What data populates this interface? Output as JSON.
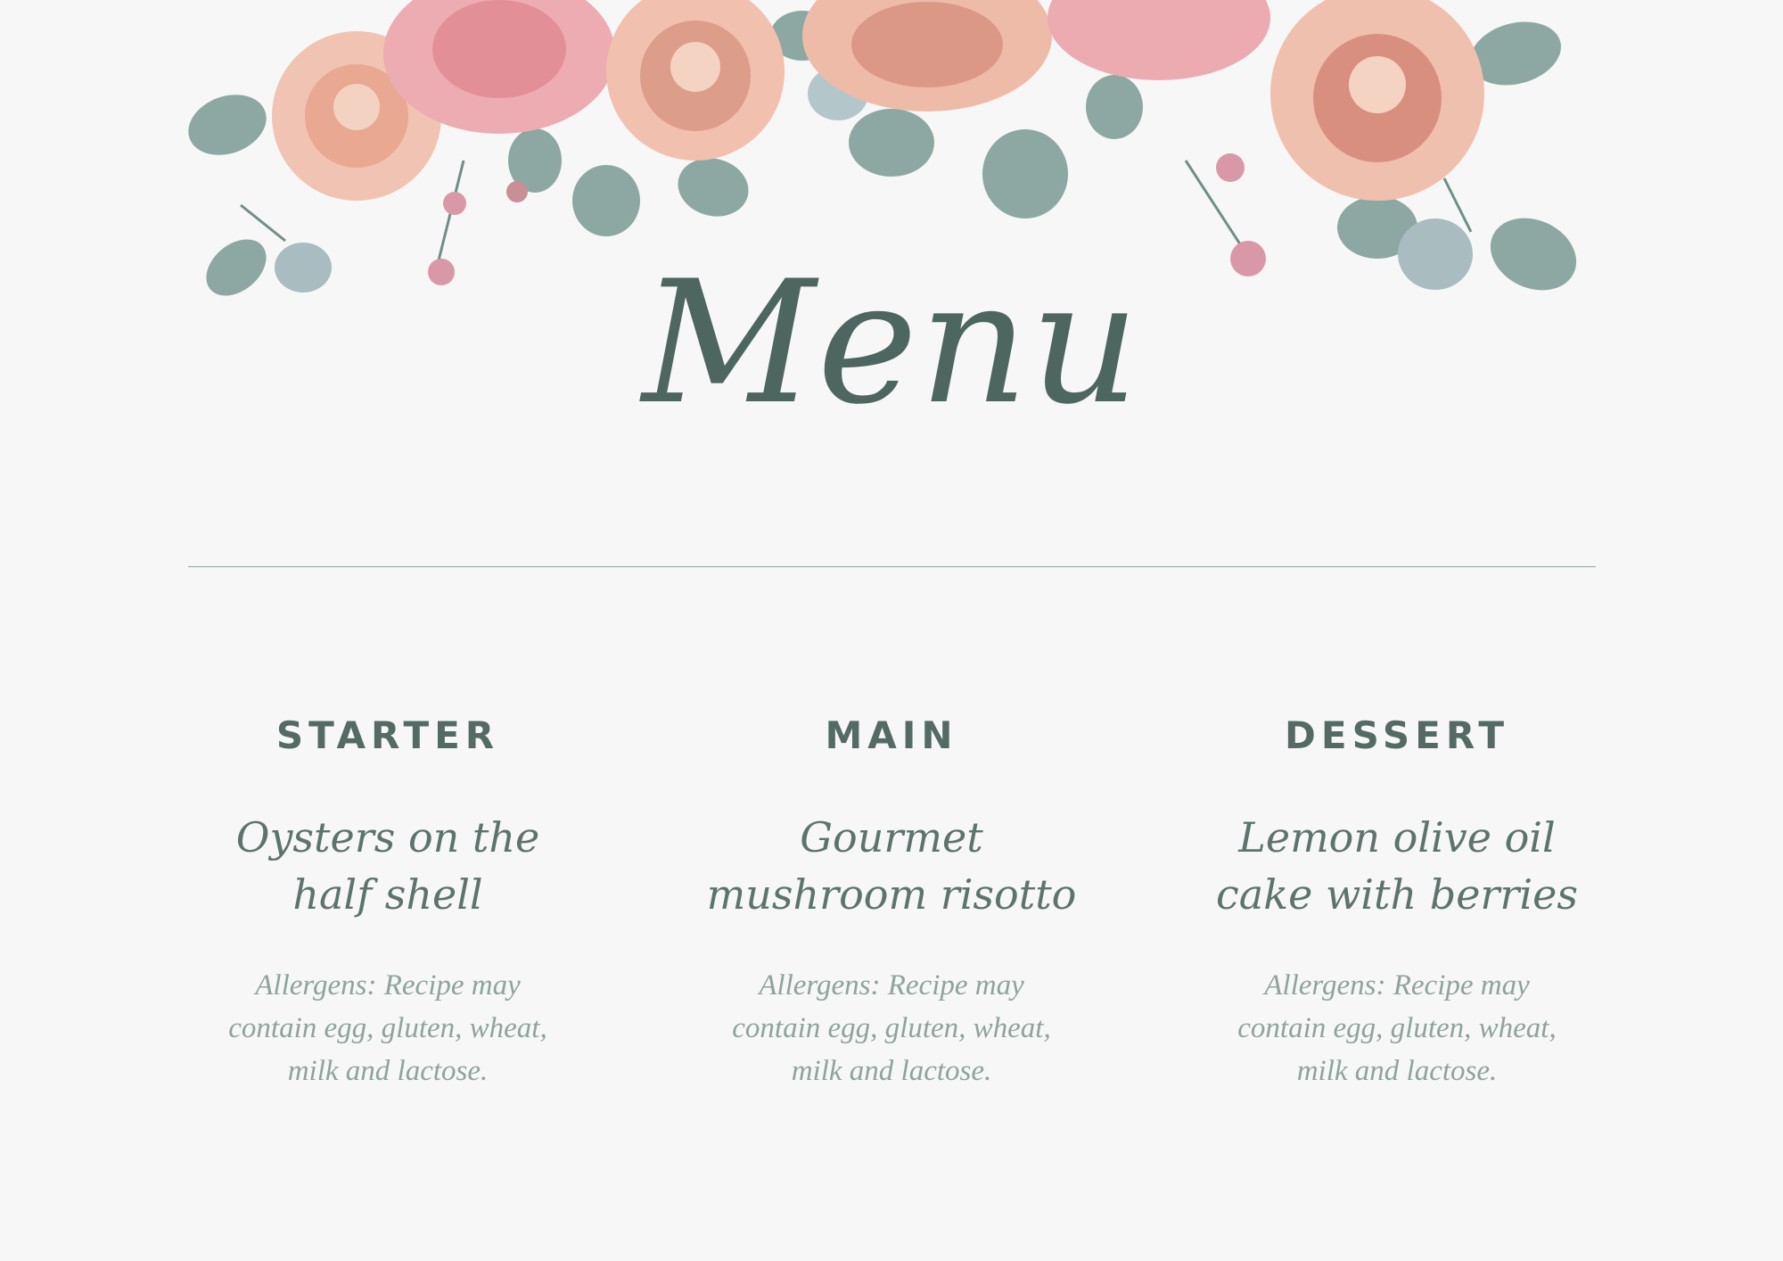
{
  "title": "Menu",
  "colors": {
    "background": "#f7f7f7",
    "accent": "#4e6660",
    "muted": "#8fa39d",
    "rose": "#f2b8a8",
    "leaf": "#6e8f88"
  },
  "courses": [
    {
      "heading": "STARTER",
      "dish": "Oysters on the half shell",
      "allergens": "Allergens: Recipe may contain egg, gluten, wheat, milk and lactose."
    },
    {
      "heading": "MAIN",
      "dish": "Gourmet mushroom risotto",
      "allergens": "Allergens: Recipe may contain egg, gluten, wheat, milk and lactose."
    },
    {
      "heading": "DESSERT",
      "dish": "Lemon olive oil cake with berries",
      "allergens": "Allergens: Recipe may contain egg, gluten, wheat, milk and lactose."
    }
  ]
}
